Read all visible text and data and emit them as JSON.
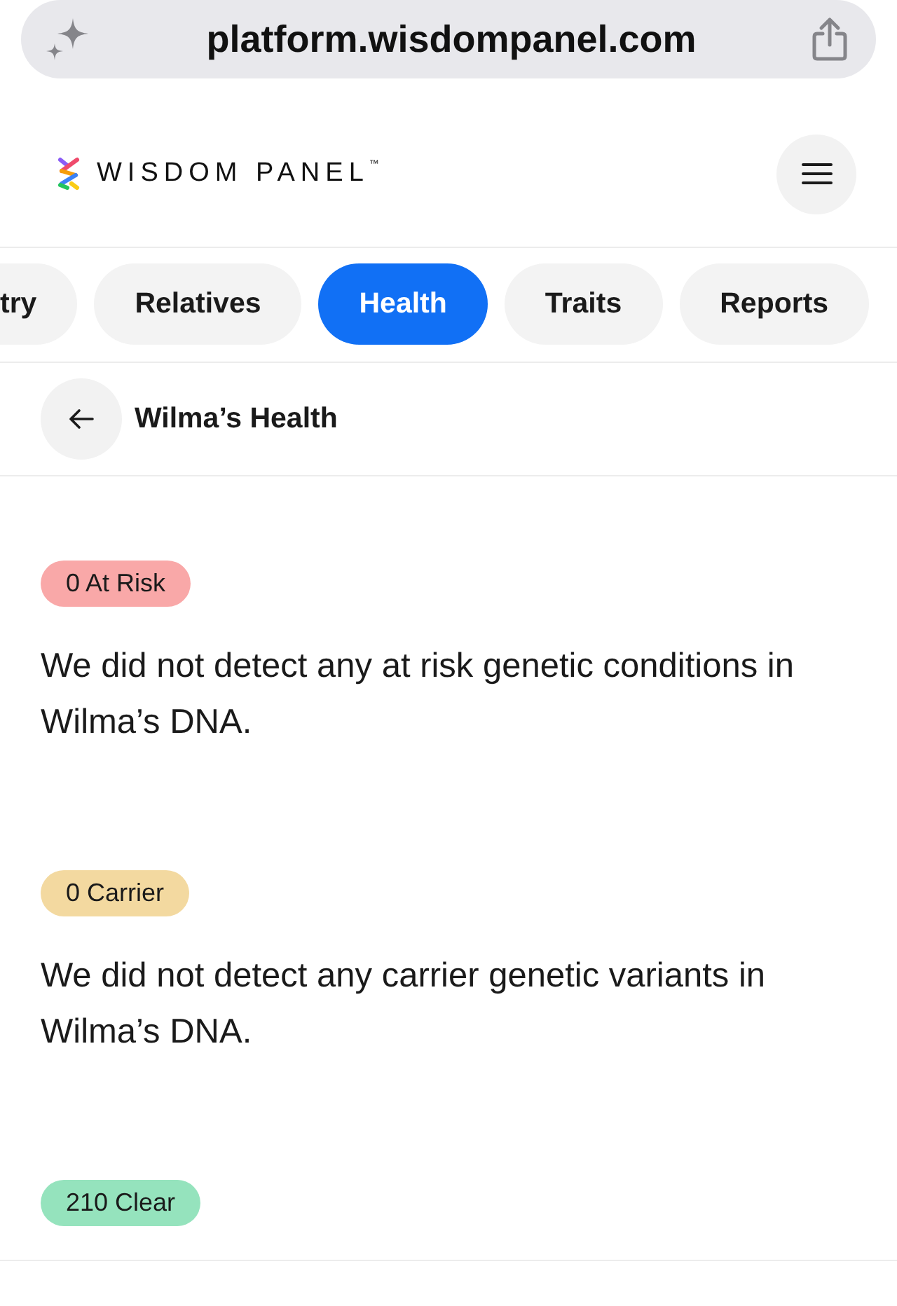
{
  "browser": {
    "url": "platform.wisdompanel.com"
  },
  "header": {
    "logo_text": "WISDOM PANEL$^{™}$"
  },
  "tabs": [
    {
      "label": "try",
      "selected": false
    },
    {
      "label": "Relatives",
      "selected": false
    },
    {
      "label": "Health",
      "selected": true
    },
    {
      "label": "Traits",
      "selected": false
    },
    {
      "label": "Reports",
      "selected": false
    }
  ],
  "page": {
    "title": "Wilma’s Health"
  },
  "sections": [
    {
      "badge": "0 At Risk",
      "color": "#f9a8a8",
      "text": "We did not detect any at risk genetic conditions in Wilma’s DNA."
    },
    {
      "badge": "0 Carrier",
      "color": "#f3d9a0",
      "text": "We did not detect any carrier genetic variants in Wilma’s DNA."
    },
    {
      "badge": "210 Clear",
      "color": "#95e3bd"
    }
  ]
}
